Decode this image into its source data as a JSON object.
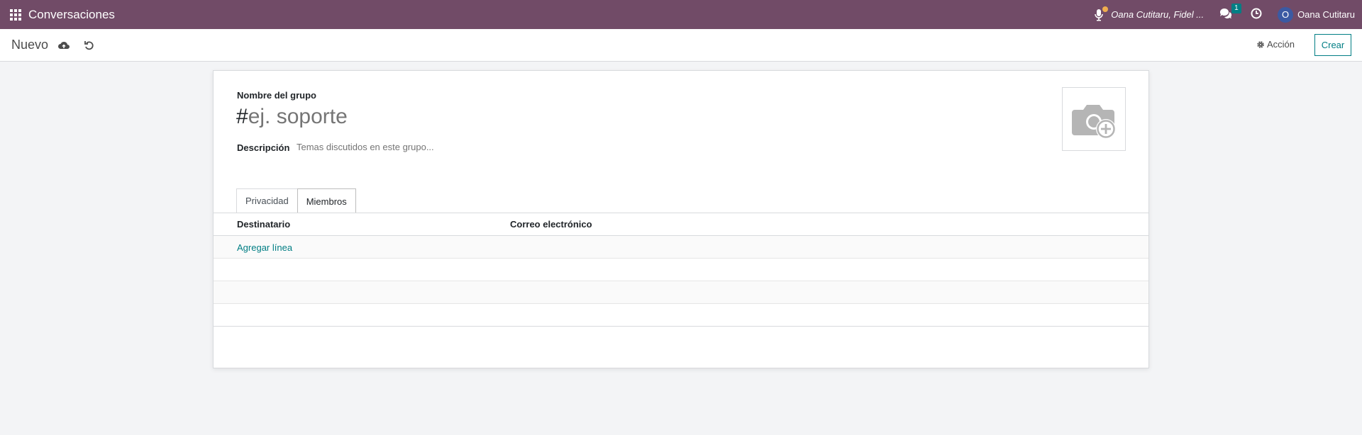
{
  "navbar": {
    "app_title": "Conversaciones",
    "activity_user": "Oana Cutitaru, Fidel ...",
    "messages_count": "1",
    "user_avatar_letter": "O",
    "user_name": "Oana Cutitaru",
    "color": "#714b67"
  },
  "control_panel": {
    "breadcrumb": "Nuevo",
    "action_label": "Acción",
    "create_label": "Crear"
  },
  "form": {
    "name_label": "Nombre del grupo",
    "name_prefix": "#",
    "name_placeholder": "ej. soporte",
    "description_label": "Descripción",
    "description_placeholder": "Temas discutidos en este grupo..."
  },
  "tabs": [
    {
      "label": "Privacidad",
      "active": false
    },
    {
      "label": "Miembros",
      "active": true
    }
  ],
  "members_table": {
    "columns": [
      "Destinatario",
      "Correo electrónico"
    ],
    "add_line_label": "Agregar línea"
  }
}
